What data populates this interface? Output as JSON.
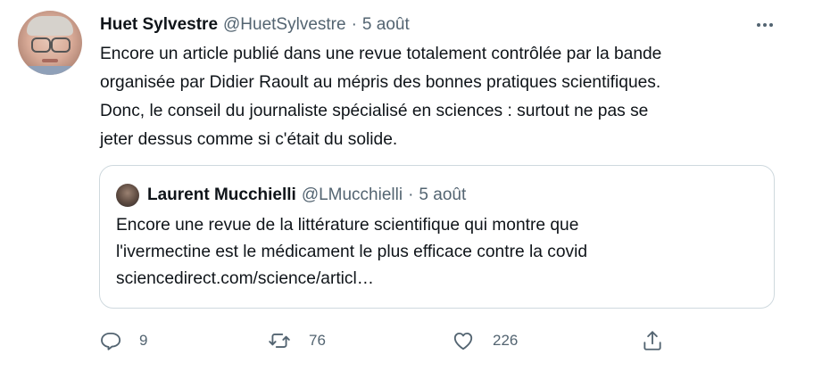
{
  "tweet": {
    "author_name": "Huet Sylvestre",
    "author_handle": "@HuetSylvestre",
    "separator": "·",
    "date": "5 août",
    "text": "Encore un article publié dans une revue totalement contrôlée par la bande\norganisée par Didier Raoult au mépris des bonnes pratiques scientifiques.\nDonc, le conseil du journaliste spécialisé en sciences : surtout ne pas se\njeter dessus comme si c'était du solide.",
    "quoted": {
      "author_name": "Laurent Mucchielli",
      "author_handle": "@LMucchielli",
      "separator": "·",
      "date": "5 août",
      "text": "Encore une revue de la littérature scientifique qui montre que\nl'ivermectine est le médicament le plus efficace contre la covid\nsciencedirect.com/science/articl…"
    },
    "actions": {
      "reply_count": "9",
      "retweet_count": "76",
      "like_count": "226"
    },
    "icons": {
      "more": "more-horizontal-icon",
      "reply": "reply-icon",
      "retweet": "retweet-icon",
      "like": "heart-icon",
      "share": "share-icon"
    },
    "colors": {
      "text": "#0f1419",
      "secondary": "#536471",
      "border": "#cfd9de"
    }
  }
}
